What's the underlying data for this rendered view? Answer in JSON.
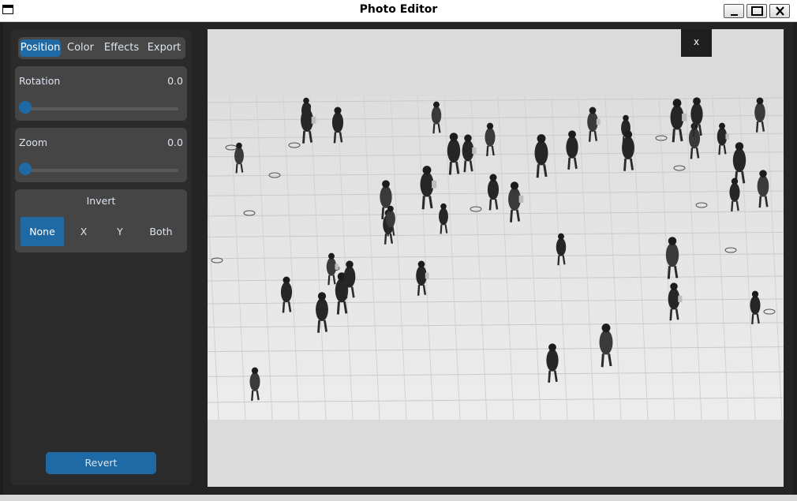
{
  "window": {
    "title": "Photo Editor",
    "icon": "window-icon",
    "controls": [
      "minimize-icon",
      "maximize-icon",
      "close-icon"
    ]
  },
  "tabs": [
    {
      "label": "Position",
      "active": true
    },
    {
      "label": "Color",
      "active": false
    },
    {
      "label": "Effects",
      "active": false
    },
    {
      "label": "Export",
      "active": false
    }
  ],
  "rotation": {
    "label": "Rotation",
    "value": "0.0",
    "slider_fraction": 0.0
  },
  "zoom": {
    "label": "Zoom",
    "value": "0.0",
    "slider_fraction": 0.0
  },
  "invert": {
    "label": "Invert",
    "options": [
      "None",
      "X",
      "Y",
      "Both"
    ],
    "selected": "None"
  },
  "revert_label": "Revert",
  "canvas": {
    "close_label": "x",
    "image_description_colors": {
      "floor": "#e8e8e8",
      "figures": "#2a2a2a"
    }
  },
  "colors": {
    "accent": "#1f6aa5",
    "panel": "#2b2b2b",
    "card": "#454545",
    "canvas_bg": "#dbdbdb"
  }
}
